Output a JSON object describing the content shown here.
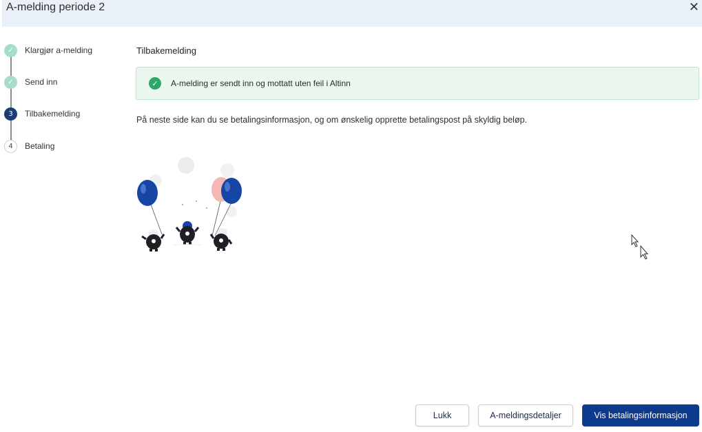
{
  "dialog": {
    "title": "A-melding periode 2",
    "close_icon": "close-icon"
  },
  "stepper": {
    "steps": [
      {
        "label": "Klargjør a-melding",
        "state": "done",
        "marker": "✓"
      },
      {
        "label": "Send inn",
        "state": "done",
        "marker": "✓"
      },
      {
        "label": "Tilbakemelding",
        "state": "active",
        "marker": "3"
      },
      {
        "label": "Betaling",
        "state": "pending",
        "marker": "4"
      }
    ]
  },
  "content": {
    "section_title": "Tilbakemelding",
    "alert": {
      "icon": "check-circle-icon",
      "text": "A-melding er sendt inn og mottatt uten feil i Altinn"
    },
    "info_text": "På neste side kan du se betalingsinformasjon, og om ønskelig opprette betalingspost på skyldig beløp."
  },
  "footer": {
    "close_label": "Lukk",
    "details_label": "A-meldingsdetaljer",
    "payment_label": "Vis betalingsinformasjon"
  },
  "colors": {
    "primary": "#0d3a8c",
    "success": "#2ea866",
    "header_bg": "#e9f0f8",
    "step_done": "#a9dcc6",
    "step_active": "#1e3c72"
  }
}
